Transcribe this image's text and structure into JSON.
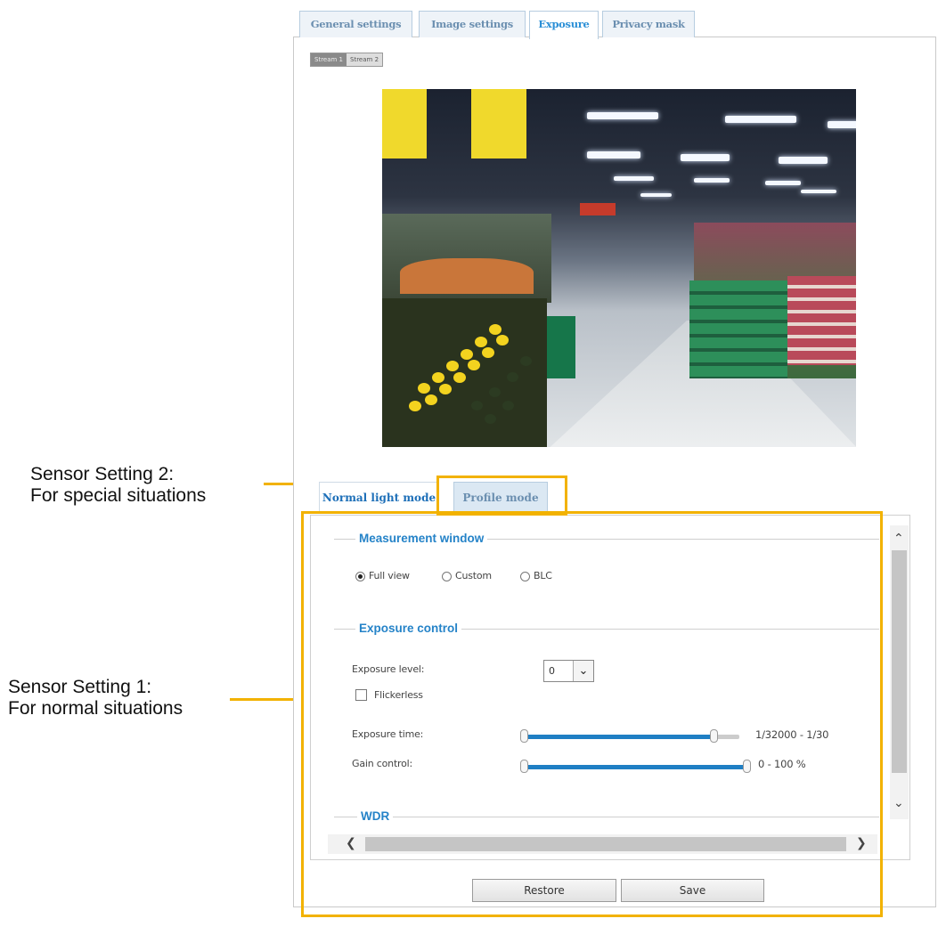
{
  "top_tabs": {
    "general": "General settings",
    "image": "Image settings",
    "exposure": "Exposure",
    "privacy": "Privacy mask"
  },
  "stream_buttons": {
    "stream1": "Stream 1",
    "stream2": "Stream 2"
  },
  "sub_tabs": {
    "normal": "Normal light mode",
    "profile": "Profile mode"
  },
  "measurement": {
    "title": "Measurement window",
    "options": [
      "Full view",
      "Custom",
      "BLC"
    ],
    "selected": "Full view"
  },
  "exposure_control": {
    "title": "Exposure control",
    "level_label": "Exposure level:",
    "level_value": "0",
    "flickerless_label": "Flickerless",
    "time_label": "Exposure time:",
    "time_range": "1/32000 - 1/30",
    "time_slider_fraction": 0.88,
    "gain_label": "Gain control:",
    "gain_range": "0 - 100 %",
    "gain_slider_fraction": 1.0
  },
  "wdr": {
    "title": "WDR"
  },
  "buttons": {
    "restore": "Restore",
    "save": "Save"
  },
  "callouts": {
    "setting2_line1": "Sensor Setting 2:",
    "setting2_line2": "For special situations",
    "setting1_line1": "Sensor Setting 1:",
    "setting1_line2": "For normal situations"
  },
  "accent_colors": {
    "highlight": "#f2b200",
    "link_blue": "#2583c8"
  }
}
